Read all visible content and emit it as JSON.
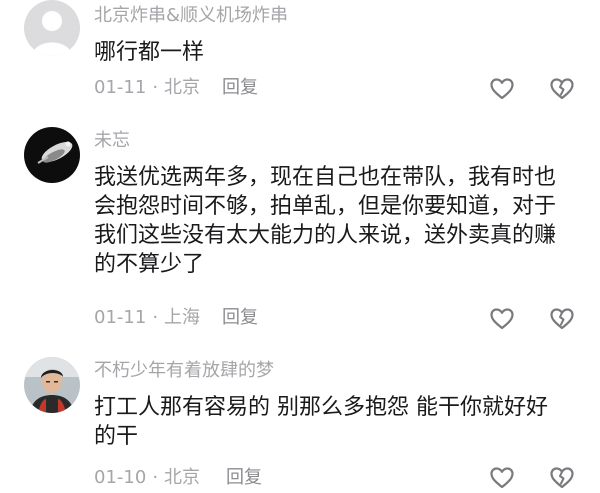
{
  "comments": [
    {
      "username": "北京炸串&顺义机场炸串",
      "lines": [
        "哪行都一样"
      ],
      "date": "01-11",
      "separator": "·",
      "location": "北京",
      "reply_label": "回复",
      "like_icon": "heart-outline-icon",
      "dislike_icon": "broken-heart-icon"
    },
    {
      "username": "未忘",
      "lines": [
        "我送优选两年多，现在自己也在带队，我有时也",
        "会抱怨时间不够，拍单乱，但是你要知道，对于",
        "我们这些没有太大能力的人来说，送外卖真的赚",
        "的不算少了"
      ],
      "date": "01-11",
      "separator": "·",
      "location": "上海",
      "reply_label": "回复",
      "like_icon": "heart-outline-icon",
      "dislike_icon": "broken-heart-icon"
    },
    {
      "username": "不朽少年有着放肆的梦",
      "lines": [
        "打工人那有容易的 别那么多抱怨 能干你就好好",
        "的干"
      ],
      "date": "01-10",
      "separator": "·",
      "location": "北京",
      "reply_label": "回复",
      "like_icon": "heart-outline-icon",
      "dislike_icon": "broken-heart-icon"
    }
  ],
  "colors": {
    "secondary_text": "#a6a6aa",
    "primary_text": "#1a1a1c",
    "icon_stroke": "#7a7a7e"
  }
}
